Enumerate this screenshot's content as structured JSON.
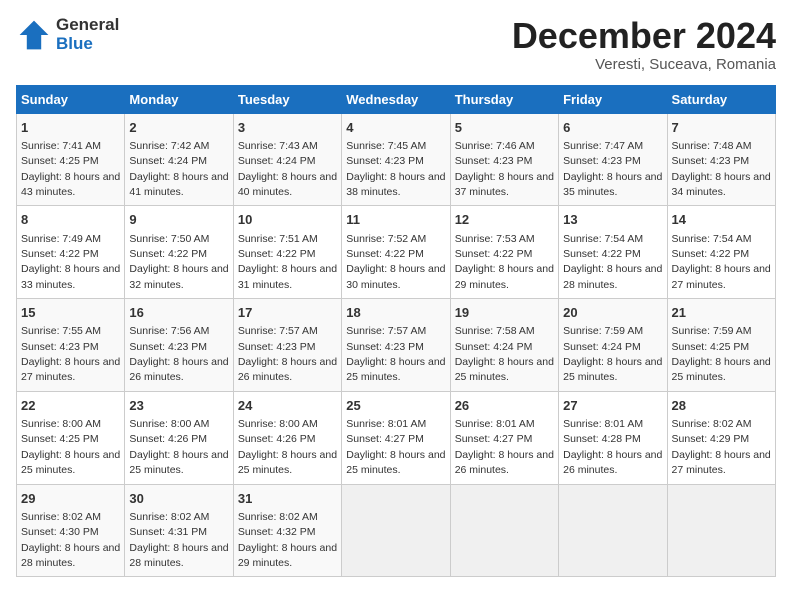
{
  "header": {
    "logo_general": "General",
    "logo_blue": "Blue",
    "month_title": "December 2024",
    "location": "Veresti, Suceava, Romania"
  },
  "days_of_week": [
    "Sunday",
    "Monday",
    "Tuesday",
    "Wednesday",
    "Thursday",
    "Friday",
    "Saturday"
  ],
  "weeks": [
    [
      {
        "day": "1",
        "sunrise": "7:41 AM",
        "sunset": "4:25 PM",
        "daylight": "8 hours and 43 minutes."
      },
      {
        "day": "2",
        "sunrise": "7:42 AM",
        "sunset": "4:24 PM",
        "daylight": "8 hours and 41 minutes."
      },
      {
        "day": "3",
        "sunrise": "7:43 AM",
        "sunset": "4:24 PM",
        "daylight": "8 hours and 40 minutes."
      },
      {
        "day": "4",
        "sunrise": "7:45 AM",
        "sunset": "4:23 PM",
        "daylight": "8 hours and 38 minutes."
      },
      {
        "day": "5",
        "sunrise": "7:46 AM",
        "sunset": "4:23 PM",
        "daylight": "8 hours and 37 minutes."
      },
      {
        "day": "6",
        "sunrise": "7:47 AM",
        "sunset": "4:23 PM",
        "daylight": "8 hours and 35 minutes."
      },
      {
        "day": "7",
        "sunrise": "7:48 AM",
        "sunset": "4:23 PM",
        "daylight": "8 hours and 34 minutes."
      }
    ],
    [
      {
        "day": "8",
        "sunrise": "7:49 AM",
        "sunset": "4:22 PM",
        "daylight": "8 hours and 33 minutes."
      },
      {
        "day": "9",
        "sunrise": "7:50 AM",
        "sunset": "4:22 PM",
        "daylight": "8 hours and 32 minutes."
      },
      {
        "day": "10",
        "sunrise": "7:51 AM",
        "sunset": "4:22 PM",
        "daylight": "8 hours and 31 minutes."
      },
      {
        "day": "11",
        "sunrise": "7:52 AM",
        "sunset": "4:22 PM",
        "daylight": "8 hours and 30 minutes."
      },
      {
        "day": "12",
        "sunrise": "7:53 AM",
        "sunset": "4:22 PM",
        "daylight": "8 hours and 29 minutes."
      },
      {
        "day": "13",
        "sunrise": "7:54 AM",
        "sunset": "4:22 PM",
        "daylight": "8 hours and 28 minutes."
      },
      {
        "day": "14",
        "sunrise": "7:54 AM",
        "sunset": "4:22 PM",
        "daylight": "8 hours and 27 minutes."
      }
    ],
    [
      {
        "day": "15",
        "sunrise": "7:55 AM",
        "sunset": "4:23 PM",
        "daylight": "8 hours and 27 minutes."
      },
      {
        "day": "16",
        "sunrise": "7:56 AM",
        "sunset": "4:23 PM",
        "daylight": "8 hours and 26 minutes."
      },
      {
        "day": "17",
        "sunrise": "7:57 AM",
        "sunset": "4:23 PM",
        "daylight": "8 hours and 26 minutes."
      },
      {
        "day": "18",
        "sunrise": "7:57 AM",
        "sunset": "4:23 PM",
        "daylight": "8 hours and 25 minutes."
      },
      {
        "day": "19",
        "sunrise": "7:58 AM",
        "sunset": "4:24 PM",
        "daylight": "8 hours and 25 minutes."
      },
      {
        "day": "20",
        "sunrise": "7:59 AM",
        "sunset": "4:24 PM",
        "daylight": "8 hours and 25 minutes."
      },
      {
        "day": "21",
        "sunrise": "7:59 AM",
        "sunset": "4:25 PM",
        "daylight": "8 hours and 25 minutes."
      }
    ],
    [
      {
        "day": "22",
        "sunrise": "8:00 AM",
        "sunset": "4:25 PM",
        "daylight": "8 hours and 25 minutes."
      },
      {
        "day": "23",
        "sunrise": "8:00 AM",
        "sunset": "4:26 PM",
        "daylight": "8 hours and 25 minutes."
      },
      {
        "day": "24",
        "sunrise": "8:00 AM",
        "sunset": "4:26 PM",
        "daylight": "8 hours and 25 minutes."
      },
      {
        "day": "25",
        "sunrise": "8:01 AM",
        "sunset": "4:27 PM",
        "daylight": "8 hours and 25 minutes."
      },
      {
        "day": "26",
        "sunrise": "8:01 AM",
        "sunset": "4:27 PM",
        "daylight": "8 hours and 26 minutes."
      },
      {
        "day": "27",
        "sunrise": "8:01 AM",
        "sunset": "4:28 PM",
        "daylight": "8 hours and 26 minutes."
      },
      {
        "day": "28",
        "sunrise": "8:02 AM",
        "sunset": "4:29 PM",
        "daylight": "8 hours and 27 minutes."
      }
    ],
    [
      {
        "day": "29",
        "sunrise": "8:02 AM",
        "sunset": "4:30 PM",
        "daylight": "8 hours and 28 minutes."
      },
      {
        "day": "30",
        "sunrise": "8:02 AM",
        "sunset": "4:31 PM",
        "daylight": "8 hours and 28 minutes."
      },
      {
        "day": "31",
        "sunrise": "8:02 AM",
        "sunset": "4:32 PM",
        "daylight": "8 hours and 29 minutes."
      },
      null,
      null,
      null,
      null
    ]
  ]
}
